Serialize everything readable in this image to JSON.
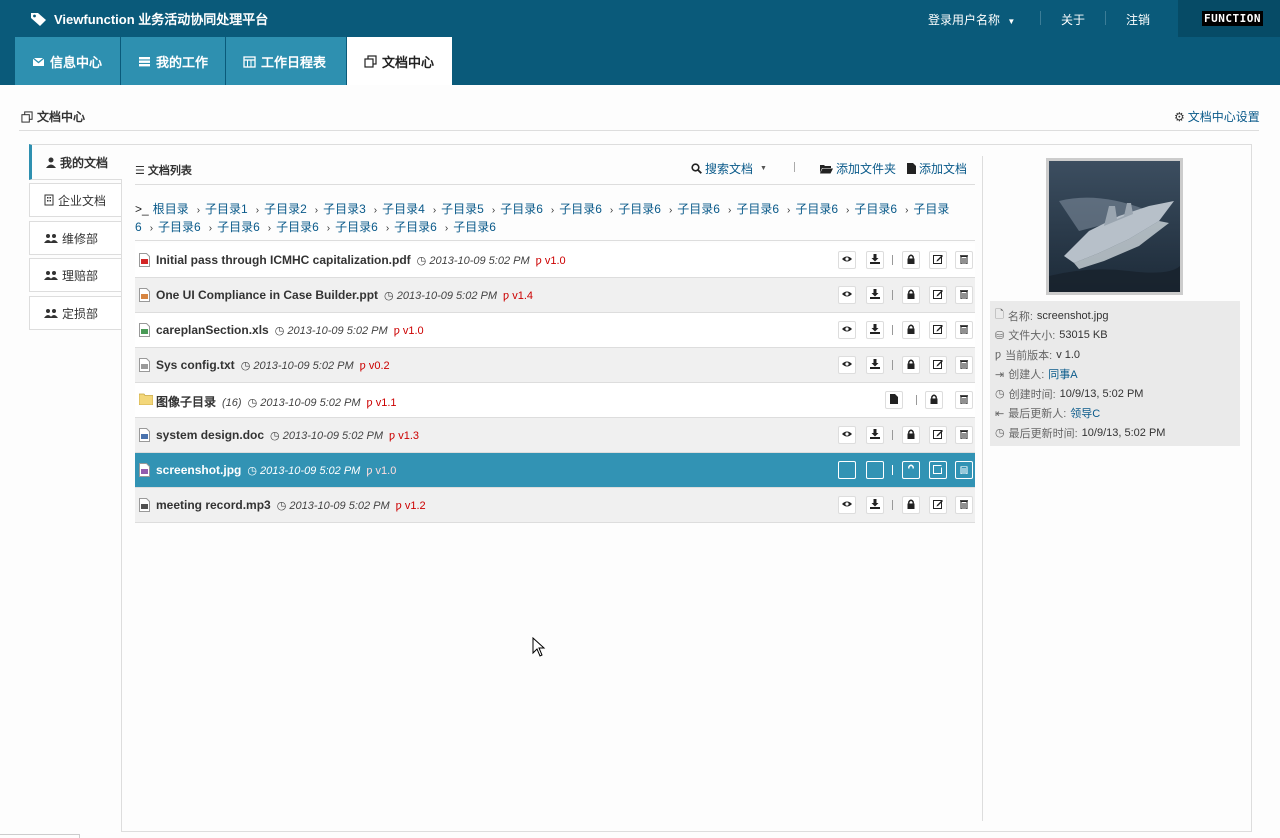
{
  "app": {
    "title": "Viewfunction 业务活动协同处理平台",
    "logo_text": "FUNCTION"
  },
  "topnav": {
    "user": "登录用户名称",
    "about": "关于",
    "logout": "注销"
  },
  "tabs": [
    {
      "label": "信息中心",
      "icon": "envelope-icon"
    },
    {
      "label": "我的工作",
      "icon": "tasks-icon"
    },
    {
      "label": "工作日程表",
      "icon": "calendar-icon"
    },
    {
      "label": "文档中心",
      "icon": "documents-icon",
      "active": true
    }
  ],
  "page": {
    "title": "文档中心",
    "settings": "文档中心设置"
  },
  "sidenav": [
    {
      "label": "我的文档",
      "icon": "user-icon",
      "active": true
    },
    {
      "label": "企业文档",
      "icon": "building-icon"
    },
    {
      "label": "维修部",
      "icon": "group-icon"
    },
    {
      "label": "理赔部",
      "icon": "group-icon"
    },
    {
      "label": "定损部",
      "icon": "group-icon"
    }
  ],
  "list": {
    "title": "文档列表",
    "search": "搜索文档",
    "add_folder": "添加文件夹",
    "add_doc": "添加文档"
  },
  "breadcrumb": [
    "根目录",
    "子目录1",
    "子目录2",
    "子目录3",
    "子目录4",
    "子目录5",
    "子目录6",
    "子目录6",
    "子目录6",
    "子目录6",
    "子目录6",
    "子目录6",
    "子目录6",
    "子目录6",
    "子目录6",
    "子目录6",
    "子目录6",
    "子目录6",
    "子目录6",
    "子目录6"
  ],
  "files": [
    {
      "name": "Initial pass through ICMHC capitalization.pdf",
      "date": "2013-10-09 5:02 PM",
      "version": "v1.0",
      "type": "pdf"
    },
    {
      "name": "One UI Compliance in Case Builder.ppt",
      "date": "2013-10-09 5:02 PM",
      "version": "v1.4",
      "type": "ppt"
    },
    {
      "name": "careplanSection.xls",
      "date": "2013-10-09 5:02 PM",
      "version": "v1.0",
      "type": "xls"
    },
    {
      "name": "Sys config.txt",
      "date": "2013-10-09 5:02 PM",
      "version": "v0.2",
      "type": "txt"
    },
    {
      "name": "图像子目录",
      "count": "(16)",
      "date": "2013-10-09 5:02 PM",
      "version": "v1.1",
      "type": "folder"
    },
    {
      "name": "system design.doc",
      "date": "2013-10-09 5:02 PM",
      "version": "v1.3",
      "type": "doc"
    },
    {
      "name": "screenshot.jpg",
      "date": "2013-10-09 5:02 PM",
      "version": "v1.0",
      "type": "jpg",
      "selected": true
    },
    {
      "name": "meeting record.mp3",
      "date": "2013-10-09 5:02 PM",
      "version": "v1.2",
      "type": "mp3"
    }
  ],
  "details": {
    "name_label": "名称:",
    "name": "screenshot.jpg",
    "size_label": "文件大小:",
    "size": "53015 KB",
    "version_label": "当前版本:",
    "version": "v 1.0",
    "creator_label": "创建人:",
    "creator": "同事A",
    "created_label": "创建时间:",
    "created": "10/9/13, 5:02 PM",
    "updater_label": "最后更新人:",
    "updater": "领导C",
    "updated_label": "最后更新时间:",
    "updated": "10/9/13, 5:02 PM"
  },
  "colors": {
    "topbar": "#0a5a7a",
    "tab": "#2e90b0",
    "selected_row": "#3293b4",
    "link": "#0a5a8a",
    "version": "#cc0000"
  }
}
